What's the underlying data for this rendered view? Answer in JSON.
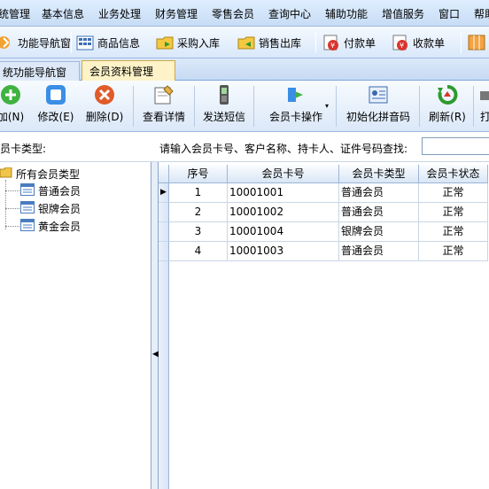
{
  "menubar": {
    "items": [
      "统管理",
      "基本信息",
      "业务处理",
      "财务管理",
      "零售会员",
      "查询中心",
      "辅助功能",
      "增值服务",
      "窗口",
      "帮助"
    ]
  },
  "quickbar": {
    "items": [
      {
        "label": "功能导航窗",
        "icon": "navigation-icon"
      },
      {
        "label": "商品信息",
        "icon": "product-grid-icon"
      },
      {
        "label": "采购入库",
        "icon": "folder-in-icon"
      },
      {
        "label": "销售出库",
        "icon": "folder-out-icon"
      },
      {
        "label": "付款单",
        "icon": "payment-icon"
      },
      {
        "label": "收款单",
        "icon": "receipt-icon"
      }
    ]
  },
  "tabs": [
    {
      "label": "统功能导航窗",
      "active": false
    },
    {
      "label": "会员资料管理",
      "active": true
    }
  ],
  "toolbar": {
    "buttons": [
      {
        "label": "加(N)",
        "icon": "add-icon"
      },
      {
        "label": "修改(E)",
        "icon": "edit-icon"
      },
      {
        "label": "删除(D)",
        "icon": "delete-icon"
      },
      {
        "label": "查看详情",
        "icon": "details-icon"
      },
      {
        "label": "发送短信",
        "icon": "phone-icon"
      },
      {
        "label": "会员卡操作",
        "icon": "card-operation-icon"
      },
      {
        "label": "初始化拼音码",
        "icon": "pinyin-icon"
      },
      {
        "label": "刷新(R)",
        "icon": "refresh-icon"
      },
      {
        "label": "打",
        "icon": "print-icon"
      }
    ]
  },
  "search": {
    "cardtype_label": "员卡类型:",
    "label": "请输入会员卡号、客户名称、持卡人、证件号码查找:",
    "value": ""
  },
  "tree": {
    "root": "所有会员类型",
    "children": [
      "普通会员",
      "银牌会员",
      "黄金会员"
    ]
  },
  "grid": {
    "columns": [
      "序号",
      "会员卡号",
      "会员卡类型",
      "会员卡状态"
    ],
    "rows": [
      {
        "no": "1",
        "card": "10001001",
        "type": "普通会员",
        "status": "正常"
      },
      {
        "no": "2",
        "card": "10001002",
        "type": "普通会员",
        "status": "正常"
      },
      {
        "no": "3",
        "card": "10001004",
        "type": "银牌会员",
        "status": "正常"
      },
      {
        "no": "4",
        "card": "10001003",
        "type": "普通会员",
        "status": "正常"
      }
    ]
  },
  "colors": {
    "accent": "#c6daf3",
    "active_tab": "#fdf2c8"
  }
}
